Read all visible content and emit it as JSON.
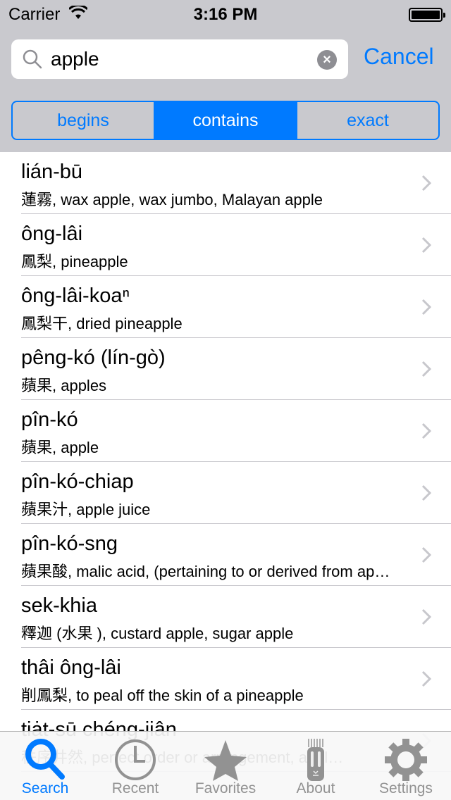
{
  "status": {
    "carrier": "Carrier",
    "time": "3:16 PM"
  },
  "search": {
    "value": "apple",
    "cancel": "Cancel"
  },
  "segments": [
    {
      "label": "begins"
    },
    {
      "label": "contains",
      "selected": true
    },
    {
      "label": "exact"
    }
  ],
  "results": [
    {
      "title": "lián-bū",
      "subtitle": "蓮霧, wax apple, wax jumbo, Malayan apple"
    },
    {
      "title": "ông-lâi",
      "subtitle": "鳳梨, pineapple"
    },
    {
      "title": "ông-lâi-koaⁿ",
      "subtitle": "鳳梨干, dried pineapple"
    },
    {
      "title": "pêng-kó (lín-gò)",
      "subtitle": "蘋果, apples"
    },
    {
      "title": "pîn-kó",
      "subtitle": "蘋果, apple"
    },
    {
      "title": "pîn-kó-chiap",
      "subtitle": "蘋果汁, apple juice"
    },
    {
      "title": "pîn-kó-sng",
      "subtitle": "蘋果酸, malic acid, (pertaining to or derived from apples)"
    },
    {
      "title": "sek-khia",
      "subtitle": "釋迦 (水果 ), custard apple, sugar apple"
    },
    {
      "title": "thâi ông-lâi",
      "subtitle": "削鳳梨, to peal off the skin of a pineapple"
    },
    {
      "title": "tiȧt-sū chéng-jiân",
      "subtitle": "秩序井然, perfect order or arrangement, appl…"
    }
  ],
  "tabs": [
    {
      "label": "Search",
      "icon": "search-icon"
    },
    {
      "label": "Recent",
      "icon": "clock-icon"
    },
    {
      "label": "Favorites",
      "icon": "star-icon"
    },
    {
      "label": "About",
      "icon": "tiki-icon"
    },
    {
      "label": "Settings",
      "icon": "gear-icon"
    }
  ],
  "colors": {
    "accent": "#007aff",
    "bar": "#c9c9ce",
    "inactive": "#929292"
  }
}
